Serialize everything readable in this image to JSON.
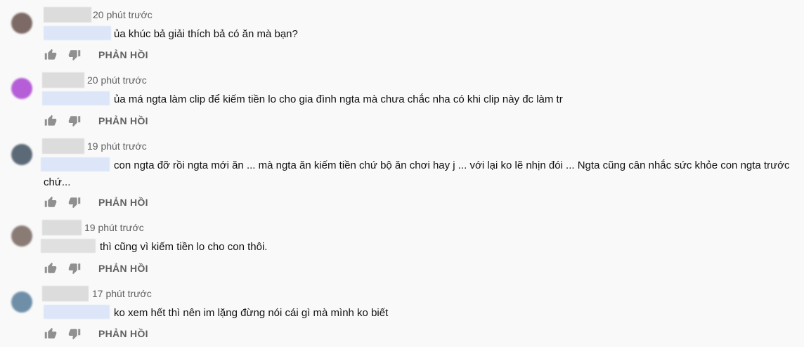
{
  "comments": [
    {
      "avatar_color": "#7d6a66",
      "time": "20 phút trước",
      "text": "ủa khúc bả giải thích bả có ăn mà bạn?",
      "reply_label": "PHẢN HỒI"
    },
    {
      "avatar_color": "#b65ed8",
      "time": "20 phút trước",
      "text": "ủa má ngta làm clip để kiếm tiền lo cho gia đình ngta mà chưa chắc nha có khi clip này đc làm tr",
      "reply_label": "PHẢN HỒI"
    },
    {
      "avatar_color": "#5c6a77",
      "time": "19 phút trước",
      "text": "con ngta đỡ rồi ngta mới ăn ... mà ngta ăn kiếm tiền chứ bộ ăn chơi hay j ... với lại ko lẽ nhịn đói ... Ngta cũng cân nhắc sức khỏe con ngta trước chứ...",
      "reply_label": "PHẢN HỒI"
    },
    {
      "avatar_color": "#8a7b75",
      "time": "19 phút trước",
      "text": "thì cũng vì kiếm tiền lo cho con thôi.",
      "reply_label": "PHẢN HỒI"
    },
    {
      "avatar_color": "#6f8fa8",
      "time": "17 phút trước",
      "text": "ko xem hết thì nên im lặng đừng nói cái gì mà mình ko biết",
      "reply_label": "PHẢN HỒI"
    }
  ]
}
